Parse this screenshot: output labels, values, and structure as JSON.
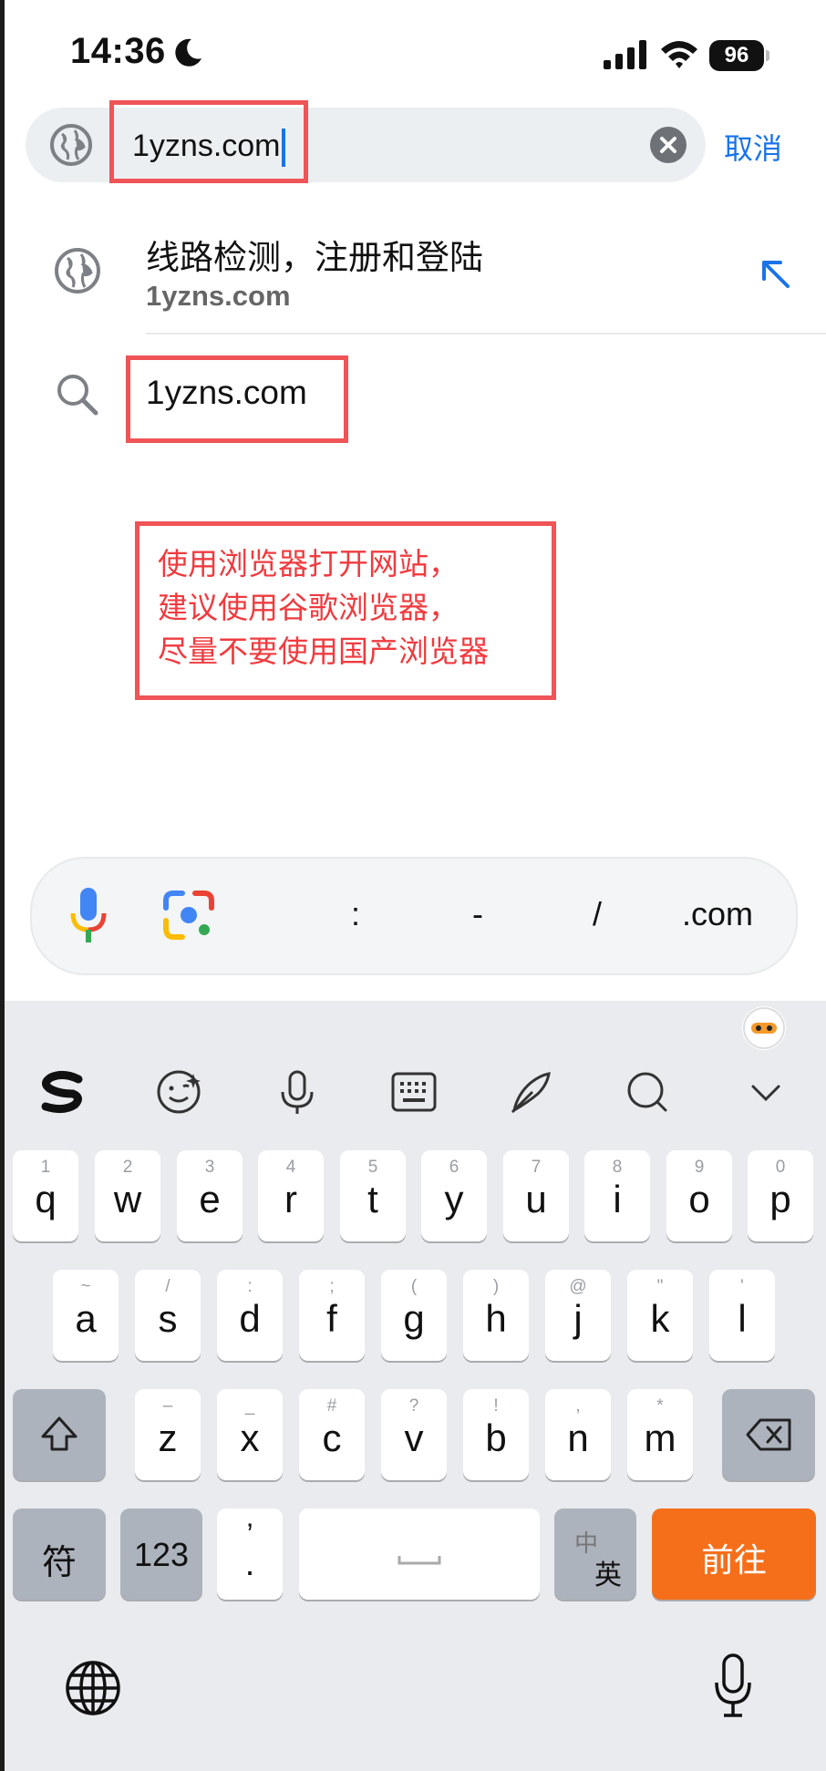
{
  "status_bar": {
    "time": "14:36",
    "battery": "96"
  },
  "address_bar": {
    "value": "1yzns.com",
    "cancel_label": "取消"
  },
  "suggestions": [
    {
      "title": "线路检测，注册和登陆",
      "subtitle": "1yzns.com"
    },
    {
      "title": "1yzns.com"
    }
  ],
  "annotation": {
    "lines": [
      "使用浏览器打开网站，",
      "建议使用谷歌浏览器，",
      "尽量不要使用国产浏览器"
    ]
  },
  "quick_keys": [
    ":",
    "-",
    "/",
    ".com"
  ],
  "keyboard": {
    "row1": [
      {
        "num": "1",
        "ch": "q"
      },
      {
        "num": "2",
        "ch": "w"
      },
      {
        "num": "3",
        "ch": "e"
      },
      {
        "num": "4",
        "ch": "r"
      },
      {
        "num": "5",
        "ch": "t"
      },
      {
        "num": "6",
        "ch": "y"
      },
      {
        "num": "7",
        "ch": "u"
      },
      {
        "num": "8",
        "ch": "i"
      },
      {
        "num": "9",
        "ch": "o"
      },
      {
        "num": "0",
        "ch": "p"
      }
    ],
    "row2": [
      {
        "num": "~",
        "ch": "a"
      },
      {
        "num": "/",
        "ch": "s"
      },
      {
        "num": ":",
        "ch": "d"
      },
      {
        "num": ";",
        "ch": "f"
      },
      {
        "num": "(",
        "ch": "g"
      },
      {
        "num": ")",
        "ch": "h"
      },
      {
        "num": "@",
        "ch": "j"
      },
      {
        "num": "\"",
        "ch": "k"
      },
      {
        "num": "'",
        "ch": "l"
      }
    ],
    "row3": [
      {
        "num": "–",
        "ch": "z"
      },
      {
        "num": "_",
        "ch": "x"
      },
      {
        "num": "#",
        "ch": "c"
      },
      {
        "num": "?",
        "ch": "v"
      },
      {
        "num": "!",
        "ch": "b"
      },
      {
        "num": ",",
        "ch": "n"
      },
      {
        "num": "*",
        "ch": "m"
      }
    ],
    "symbols_label": "符",
    "numbers_label": "123",
    "punct_top": "’",
    "punct_bottom": ".",
    "lang_top": "中",
    "lang_bottom": "英",
    "go_label": "前往"
  }
}
